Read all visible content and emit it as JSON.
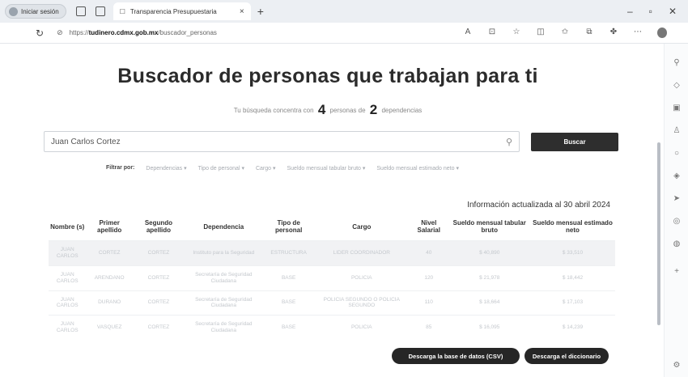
{
  "browser": {
    "profile_label": "Iniciar sesión",
    "tab_title": "Transparencia Presupuestaria",
    "tab_close": "×",
    "new_tab": "+",
    "url_prefix": "https://",
    "url_domain": "tudinero.cdmx.gob.mx",
    "url_path": "/buscador_personas"
  },
  "header": {
    "title": "Buscador de personas que trabajan para ti",
    "subtitle_prefix": "Tu búsqueda concentra con",
    "people_count": "4",
    "subtitle_mid": "personas de",
    "dep_count": "2",
    "subtitle_suffix": "dependencias"
  },
  "search": {
    "value": "Juan Carlos Cortez",
    "button_label": "Buscar"
  },
  "filters": {
    "label": "Filtrar por:",
    "items": [
      "Dependencias ▾",
      "Tipo de personal ▾",
      "Cargo ▾",
      "Sueldo mensual tabular bruto ▾",
      "Sueldo mensual estimado neto ▾"
    ]
  },
  "updated_text": "Información actualizada al 30 abril 2024",
  "table": {
    "headers": [
      "Nombre (s)",
      "Primer apellido",
      "Segundo apellido",
      "Dependencia",
      "Tipo de personal",
      "Cargo",
      "Nivel Salarial",
      "Sueldo mensual tabular bruto",
      "Sueldo mensual estimado neto"
    ],
    "rows": [
      [
        "JUAN CARLOS",
        "CORTEZ",
        "CORTEZ",
        "Instituto para la Seguridad",
        "ESTRUCTURA",
        "LIDER COORDINADOR",
        "40",
        "$ 40,890",
        "$ 33,510"
      ],
      [
        "JUAN CARLOS",
        "ARENDANO",
        "CORTEZ",
        "Secretaría de Seguridad Ciudadana",
        "BASE",
        "POLICIA",
        "120",
        "$ 21,978",
        "$ 18,442"
      ],
      [
        "JUAN CARLOS",
        "DURANO",
        "CORTEZ",
        "Secretaría de Seguridad Ciudadana",
        "BASE",
        "POLICIA SEGUNDO O POLICIA SEGUNDO",
        "110",
        "$ 18,664",
        "$ 17,103"
      ],
      [
        "JUAN CARLOS",
        "VASQUEZ",
        "CORTEZ",
        "Secretaría de Seguridad Ciudadana",
        "BASE",
        "POLICIA",
        "85",
        "$ 16,095",
        "$ 14,239"
      ]
    ]
  },
  "downloads": {
    "csv_label": "Descarga la base de datos (CSV)",
    "dict_label": "Descarga el diccionario"
  }
}
